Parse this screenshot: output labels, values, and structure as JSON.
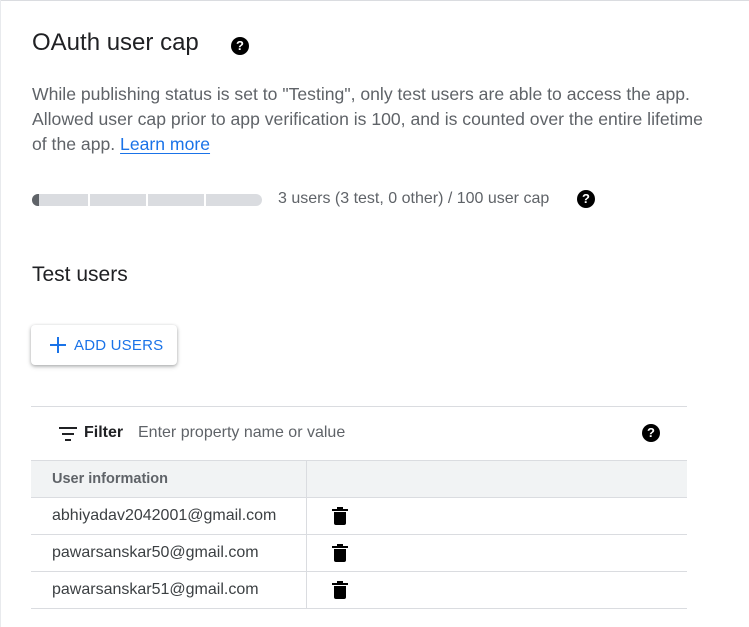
{
  "oauth": {
    "title": "OAuth user cap",
    "description": "While publishing status is set to \"Testing\", only test users are able to access the app. Allowed user cap prior to app verification is 100, and is counted over the entire lifetime of the app.",
    "learn_more": "Learn more",
    "usage_fraction": 0.03,
    "usage_text": "3 users (3 test, 0 other) / 100 user cap"
  },
  "test_users": {
    "title": "Test users",
    "add_button_label": "ADD USERS",
    "filter": {
      "label": "Filter",
      "placeholder": "Enter property name or value"
    },
    "columns": [
      "User information",
      ""
    ],
    "rows": [
      {
        "email": "abhiyadav2042001@gmail.com"
      },
      {
        "email": "pawarsanskar50@gmail.com"
      },
      {
        "email": "pawarsanskar51@gmail.com"
      }
    ]
  },
  "icons": {
    "help": "help-icon",
    "filter": "filter-icon",
    "add": "plus-icon",
    "delete": "trash-icon"
  },
  "colors": {
    "accent": "#1a73e8",
    "bar_fill": "#5f6368",
    "bar_track": "#dadce0",
    "header_bg": "#f1f3f4"
  }
}
